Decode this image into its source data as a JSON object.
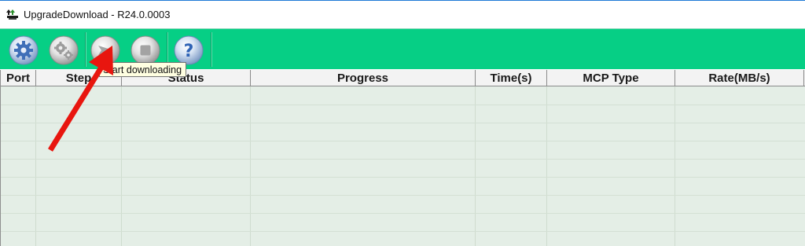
{
  "window": {
    "title": "UpgradeDownload - R24.0.0003",
    "icon": "upgrade-download-app-icon"
  },
  "toolbar": {
    "background": "#06cf85",
    "buttons": [
      {
        "name": "settings-button",
        "icon": "gear-icon"
      },
      {
        "name": "advanced-settings-button",
        "icon": "gears-icon"
      },
      {
        "name": "start-button",
        "icon": "play-arrow-icon"
      },
      {
        "name": "stop-button",
        "icon": "stop-icon"
      },
      {
        "name": "help-button",
        "icon": "question-mark-icon"
      }
    ]
  },
  "tooltip": {
    "text": "Start downloading"
  },
  "table": {
    "columns": [
      "Port",
      "Step",
      "Status",
      "Progress",
      "Time(s)",
      "MCP Type",
      "Rate(MB/s)"
    ],
    "rows": []
  },
  "annotation": {
    "type": "red-arrow",
    "color": "#e8160f"
  }
}
